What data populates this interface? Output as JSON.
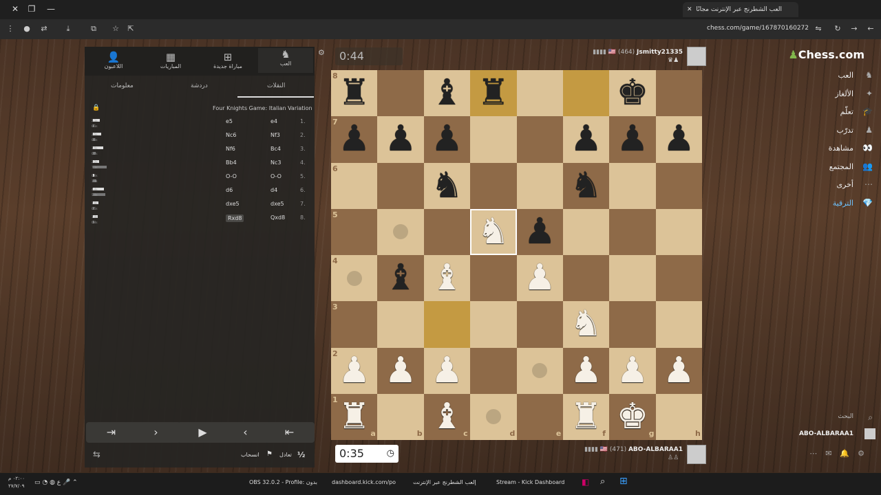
{
  "browser": {
    "tab_title": "العب الشطرنج عبر الإنترنت مجانًا",
    "url": "chess.com/game/167870160272"
  },
  "panel": {
    "tabs": [
      {
        "label": "العب",
        "icon": "play-icon"
      },
      {
        "label": "مباراة جديدة",
        "icon": "plus-icon"
      },
      {
        "label": "المباريات",
        "icon": "games-icon"
      },
      {
        "label": "اللاعبون",
        "icon": "players-icon"
      }
    ],
    "subtabs": [
      "النقلات",
      "دردشة",
      "معلومات"
    ],
    "opening": "Four Knights Game: Italian Variation",
    "moves": [
      {
        "n": "1.",
        "w": "e4",
        "b": "e5",
        "t1": "2.1s",
        "t2": "0.1s",
        "bw1": 10,
        "bw2": 2
      },
      {
        "n": "2.",
        "w": "Nf3",
        "b": "Nc6",
        "t1": "2.5s",
        "t2": "0.3s",
        "bw1": 12,
        "bw2": 3
      },
      {
        "n": "3.",
        "w": "Bc4",
        "b": "Nf6",
        "t1": "3.9s",
        "t2": "0.7s",
        "bw1": 15,
        "bw2": 4
      },
      {
        "n": "4.",
        "w": "Nc3",
        "b": "Bb4",
        "t1": "2.2s",
        "t2": "7.1s",
        "bw1": 9,
        "bw2": 20
      },
      {
        "n": "5.",
        "w": "O-O",
        "b": "O-O",
        "t1": "0.0s",
        "t2": "1.1s",
        "bw1": 2,
        "bw2": 5
      },
      {
        "n": "6.",
        "w": "d4",
        "b": "d6",
        "t1": "4.4s",
        "t2": "5.9s",
        "bw1": 16,
        "bw2": 18
      },
      {
        "n": "7.",
        "w": "dxe5",
        "b": "dxe5",
        "t1": "1.8s",
        "t2": "0.5s",
        "bw1": 8,
        "bw2": 2
      },
      {
        "n": "8.",
        "w": "Qxd8",
        "b": "Rxd8",
        "t1": "1.4s",
        "t2": "0.4s",
        "bw1": 7,
        "bw2": 2
      }
    ],
    "controls": [
      "first-icon",
      "prev-icon",
      "play-icon",
      "next-icon",
      "last-icon"
    ],
    "draw_label": "تعادل",
    "resign_label": "انسحاب",
    "draw_symbol": "½"
  },
  "top_player": {
    "name": "Jsmitty21335",
    "rating": "(464)",
    "clock": "0:44"
  },
  "bottom_player": {
    "name": "ABO-ALBARAA1",
    "rating": "(471)",
    "clock": "0:35"
  },
  "board": {
    "ranks": [
      "8",
      "7",
      "6",
      "5",
      "4",
      "3",
      "2",
      "1"
    ],
    "files": [
      "a",
      "b",
      "c",
      "d",
      "e",
      "f",
      "g",
      "h"
    ],
    "pieces": [
      [
        "br",
        "",
        "bb",
        "br",
        "",
        "",
        "bk",
        ""
      ],
      [
        "bp",
        "bp",
        "bp",
        "",
        "",
        "bp",
        "bp",
        "bp"
      ],
      [
        "",
        "",
        "bn",
        "",
        "",
        "bn",
        "",
        ""
      ],
      [
        "",
        "",
        "",
        "wn",
        "bp",
        "",
        "",
        ""
      ],
      [
        "",
        "bb",
        "wb",
        "",
        "wp",
        "",
        "",
        ""
      ],
      [
        "",
        "",
        "",
        "",
        "",
        "wn",
        "",
        ""
      ],
      [
        "wp",
        "wp",
        "wp",
        "",
        "",
        "wp",
        "wp",
        "wp"
      ],
      [
        "wr",
        "",
        "wb",
        "",
        "",
        "wr",
        "wk",
        ""
      ]
    ]
  },
  "site": {
    "logo": "Chess.com",
    "nav": [
      {
        "label": "العب",
        "icon": "play-icon"
      },
      {
        "label": "الألغاز",
        "icon": "puzzle-icon"
      },
      {
        "label": "تعلّم",
        "icon": "learn-icon"
      },
      {
        "label": "تدرّب",
        "icon": "train-icon"
      },
      {
        "label": "مشاهدة",
        "icon": "watch-icon"
      },
      {
        "label": "المجتمع",
        "icon": "community-icon"
      },
      {
        "label": "أخرى",
        "icon": "more-icon"
      },
      {
        "label": "الترقية",
        "icon": "diamond-icon"
      }
    ],
    "search_label": "البحث",
    "username": "ABO-ALBARAA1"
  },
  "taskbar": {
    "items": [
      "OBS 32.0.2 - Profile: بدون",
      "dashboard.kick.com/po",
      "إلعب الشطرنج عبر الإنترنت",
      "Stream - Kick Dashboard"
    ],
    "time": "٠٢:٠٠ م",
    "date": "٢٧/٧/٠٩"
  }
}
